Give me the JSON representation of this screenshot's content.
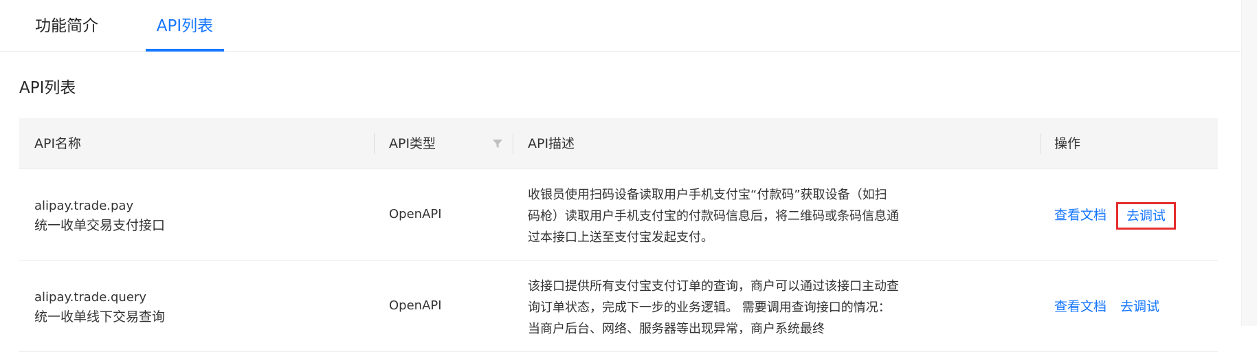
{
  "tabs": [
    {
      "label": "功能简介",
      "active": false
    },
    {
      "label": "API列表",
      "active": true
    }
  ],
  "section_title": "API列表",
  "table": {
    "headers": {
      "name": "API名称",
      "type": "API类型",
      "desc": "API描述",
      "op": "操作"
    },
    "rows": [
      {
        "api_id": "alipay.trade.pay",
        "api_cn": "统一收单交易支付接口",
        "type": "OpenAPI",
        "desc": "收银员使用扫码设备读取用户手机支付宝“付款码”获取设备（如扫码枪）读取用户手机支付宝的付款码信息后，将二维码或条码信息通过本接口上送至支付宝发起支付。",
        "op_doc": "查看文档",
        "op_debug": "去调试"
      },
      {
        "api_id": "alipay.trade.query",
        "api_cn": "统一收单线下交易查询",
        "type": "OpenAPI",
        "desc": "该接口提供所有支付宝支付订单的查询，商户可以通过该接口主动查询订单状态，完成下一步的业务逻辑。 需要调用查询接口的情况： 当商户后台、网络、服务器等出现异常，商户系统最终",
        "op_doc": "查看文档",
        "op_debug": "去调试"
      }
    ]
  },
  "colors": {
    "accent": "#1677ff",
    "highlight_border": "#e52d2d",
    "header_bg": "#f5f5f5"
  },
  "icons": {
    "filter": "filter-icon"
  }
}
